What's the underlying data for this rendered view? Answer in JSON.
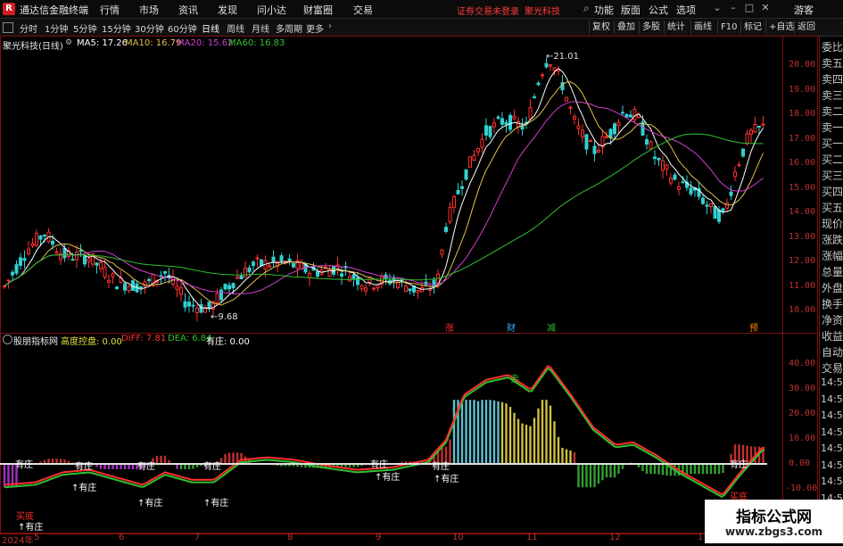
{
  "app": {
    "title": "通达信金融终端",
    "logo": "R"
  },
  "menu": [
    "行情",
    "市场",
    "资讯",
    "发现",
    "问小达",
    "财富圈",
    "交易"
  ],
  "account_notice": "证券交易未登录",
  "stock_name_title": "聚光科技",
  "top_right": [
    "功能",
    "版面",
    "公式",
    "选项"
  ],
  "guest": "游客",
  "timeframes": [
    "分时",
    "1分钟",
    "5分钟",
    "15分钟",
    "30分钟",
    "60分钟",
    "日线",
    "周线",
    "月线",
    "多周期",
    "更多"
  ],
  "active_timeframe": "日线",
  "right_tools": [
    "复权",
    "叠加",
    "多股",
    "统计",
    "画线",
    "F10",
    "标记",
    "+自选",
    "返回"
  ],
  "main_chart": {
    "title": "聚光科技(日线)",
    "ma": [
      {
        "label": "MA5: 17.26",
        "color": "#ffffff"
      },
      {
        "label": "MA10: 16.79",
        "color": "#e0c050"
      },
      {
        "label": "MA20: 15.62",
        "color": "#d040d0"
      },
      {
        "label": "MA60: 16.83",
        "color": "#30c030"
      }
    ],
    "high_label": "21.01",
    "low_label": "9.68",
    "markers": [
      {
        "text": "涨",
        "color": "#ff3030"
      },
      {
        "text": "财",
        "color": "#30b0ff"
      },
      {
        "text": "减",
        "color": "#30c030"
      },
      {
        "text": "预",
        "color": "#ff8000"
      }
    ]
  },
  "side_panel": [
    "委比",
    "卖五",
    "卖四",
    "卖三",
    "卖二",
    "卖一",
    "买一",
    "买二",
    "买三",
    "买四",
    "买五",
    "现价",
    "涨跌",
    "涨幅",
    "总量",
    "外盘",
    "换手",
    "净资",
    "收益",
    "自动",
    "交易"
  ],
  "side_times": [
    "14:56",
    "14:56",
    "14:56",
    "14:56",
    "14:56",
    "14:56",
    "14:56",
    "14:56"
  ],
  "indicator": {
    "name": "股朋指标网",
    "items": [
      {
        "label": "高度控盘: 0.00",
        "color": "#e0e040"
      },
      {
        "label": "DIFF: 7.81",
        "color": "#ff3030"
      },
      {
        "label": "DEA: 6.84",
        "color": "#30c030"
      },
      {
        "label": "有庄: 0.00",
        "color": "#ffffff"
      }
    ],
    "annotations": [
      "有庄",
      "有庄",
      "有庄",
      "有庄",
      "有庄",
      "有庄",
      "有庄"
    ],
    "below_annotations": [
      "有庄",
      "有庄",
      "有庄",
      "有庄",
      "有庄",
      "有庄"
    ],
    "buy_labels": [
      "买底",
      "买底"
    ],
    "sell_label": "卖"
  },
  "y_axis_main": [
    "20.00",
    "19.00",
    "18.00",
    "17.00",
    "16.00",
    "15.00",
    "14.00",
    "13.00",
    "12.00",
    "11.00",
    "10.00"
  ],
  "y_axis_ind": [
    "40.00",
    "30.00",
    "20.00",
    "10.00",
    "0.00",
    "-10.00"
  ],
  "x_axis": [
    "2024年",
    "5",
    "6",
    "7",
    "8",
    "9",
    "10",
    "11",
    "12",
    "1"
  ],
  "watermark": {
    "title": "指标公式网",
    "url": "www.zbgs3.com"
  },
  "colors": {
    "up": "#ff3030",
    "down": "#30d0d0",
    "ma60": "#30c030",
    "frame": "#7a1010"
  }
}
